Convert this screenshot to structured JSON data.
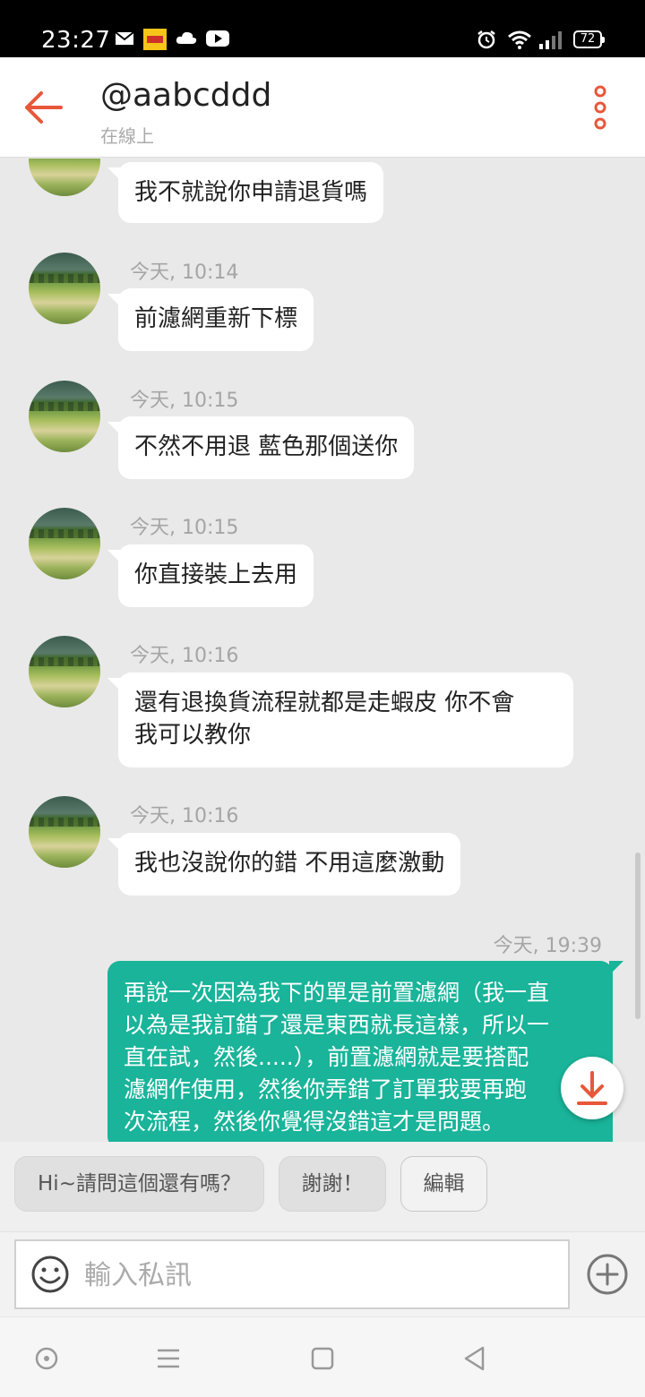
{
  "status_bar": {
    "time": "23:27",
    "battery": "72",
    "icons": [
      "mail-icon",
      "app-badge-icon",
      "cloud-icon",
      "youtube-icon",
      "alarm-icon",
      "wifi-icon",
      "signal-icon",
      "battery-icon"
    ]
  },
  "header": {
    "title": "@aabcddd",
    "subtitle": "在線上"
  },
  "messages": [
    {
      "direction": "in",
      "timestamp": "",
      "text": "我不就說你申請退貨嗎"
    },
    {
      "direction": "in",
      "timestamp": "今天, 10:14",
      "text": "前濾網重新下標"
    },
    {
      "direction": "in",
      "timestamp": "今天, 10:15",
      "text": "不然不用退 藍色那個送你"
    },
    {
      "direction": "in",
      "timestamp": "今天, 10:15",
      "text": "你直接裝上去用"
    },
    {
      "direction": "in",
      "timestamp": "今天, 10:16",
      "text_lines": [
        "還有退換貨流程就都是走蝦皮 你不會",
        "我可以教你"
      ]
    },
    {
      "direction": "in",
      "timestamp": "今天, 10:16",
      "text": "我也沒說你的錯 不用這麼激動"
    },
    {
      "direction": "out",
      "timestamp": "今天, 19:39",
      "text_lines": [
        "再說一次因為我下的單是前置濾網（我一直",
        "以為是我訂錯了還是東西就長這樣，所以一",
        "直在試，然後.....），前置濾網就是要搭配",
        "濾網作使用，然後你弄錯了訂單我要再跑",
        "次流程，然後你覺得沒錯這才是問題。"
      ]
    }
  ],
  "quick_replies": [
    "Hi~請問這個還有嗎？",
    "謝謝！",
    "編輯"
  ],
  "input": {
    "placeholder": "輸入私訊",
    "value": ""
  },
  "colors": {
    "accent": "#e8573a",
    "outgoing_bubble": "#19b49a",
    "incoming_bubble": "#ffffff",
    "background": "#e9e9e9"
  }
}
